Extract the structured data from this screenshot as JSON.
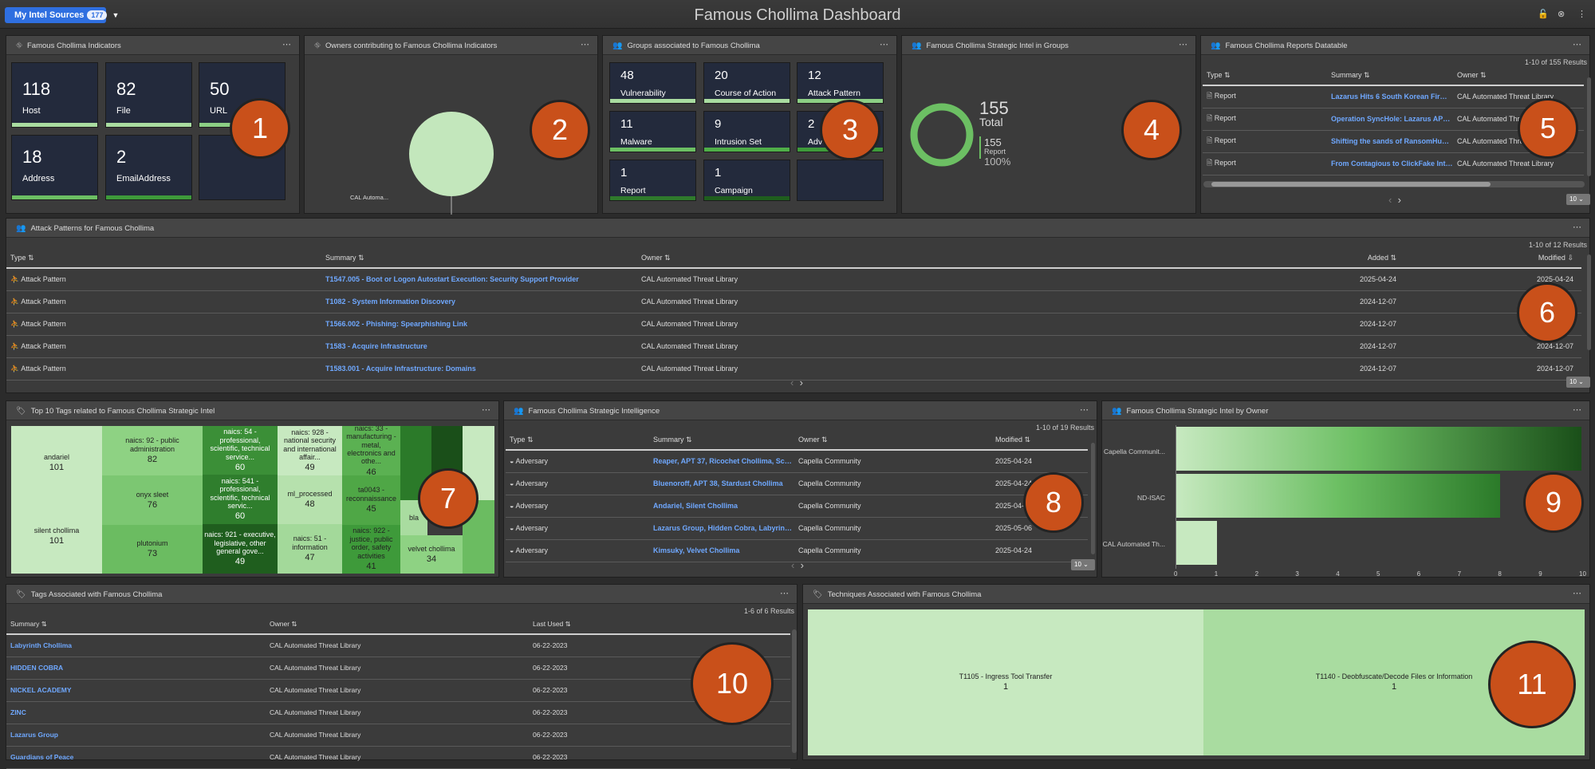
{
  "app": {
    "sources_label": "My Intel Sources",
    "sources_count": "177",
    "title": "Famous Chollima Dashboard"
  },
  "icons": {
    "lock": "lock-icon",
    "close": "close-circle-icon",
    "more": "more-vertical-icon"
  },
  "badges": [
    "1",
    "2",
    "3",
    "4",
    "5",
    "6",
    "7",
    "8",
    "9",
    "10",
    "11"
  ],
  "p1": {
    "title": "Famous Chollima Indicators",
    "tiles": [
      {
        "value": "118",
        "label": "Host"
      },
      {
        "value": "82",
        "label": "File"
      },
      {
        "value": "50",
        "label": "URL"
      },
      {
        "value": "18",
        "label": "Address"
      },
      {
        "value": "2",
        "label": "EmailAddress"
      }
    ]
  },
  "p2": {
    "title": "Owners contributing to Famous Chollima Indicators",
    "slice_label": "CAL Automa..."
  },
  "p3": {
    "title": "Groups associated to Famous Chollima",
    "tiles": [
      {
        "value": "48",
        "label": "Vulnerability"
      },
      {
        "value": "20",
        "label": "Course of Action"
      },
      {
        "value": "12",
        "label": "Attack Pattern"
      },
      {
        "value": "11",
        "label": "Malware"
      },
      {
        "value": "9",
        "label": "Intrusion Set"
      },
      {
        "value": "2",
        "label": "Adversary"
      },
      {
        "value": "1",
        "label": "Report"
      },
      {
        "value": "1",
        "label": "Campaign"
      }
    ]
  },
  "p4": {
    "title": "Famous Chollima Strategic Intel in Groups",
    "total": "155",
    "total_label": "Total",
    "sub_value": "155",
    "sub_label": "Report",
    "percent": "100%"
  },
  "p5": {
    "title": "Famous Chollima Reports Datatable",
    "results": "1-10 of 155 Results",
    "columns": [
      "Type",
      "Summary",
      "Owner"
    ],
    "rows": [
      [
        "Report",
        "Lazarus Hits 6 South Korean Firms v...",
        "CAL Automated Threat Library"
      ],
      [
        "Report",
        "Operation SyncHole: Lazarus APT g...",
        "CAL Automated Threat Library"
      ],
      [
        "Report",
        "Shifting the sands of RansomHub's ...",
        "CAL Automated Threat Library"
      ],
      [
        "Report",
        "From Contagious to ClickFake Interv...",
        "CAL Automated Threat Library"
      ]
    ],
    "page_size": "10"
  },
  "p6": {
    "title": "Attack Patterns for Famous Chollima",
    "results": "1-10 of 12 Results",
    "columns": [
      "Type",
      "Summary",
      "Owner",
      "Added",
      "Modified"
    ],
    "rows": [
      [
        "Attack Pattern",
        "T1547.005 - Boot or Logon Autostart Execution: Security Support Provider",
        "CAL Automated Threat Library",
        "2025-04-24",
        "2025-04-24"
      ],
      [
        "Attack Pattern",
        "T1082 - System Information Discovery",
        "CAL Automated Threat Library",
        "2024-12-07",
        "2024-12-07"
      ],
      [
        "Attack Pattern",
        "T1566.002 - Phishing: Spearphishing Link",
        "CAL Automated Threat Library",
        "2024-12-07",
        "2024-12-07"
      ],
      [
        "Attack Pattern",
        "T1583 - Acquire Infrastructure",
        "CAL Automated Threat Library",
        "2024-12-07",
        "2024-12-07"
      ],
      [
        "Attack Pattern",
        "T1583.001 - Acquire Infrastructure: Domains",
        "CAL Automated Threat Library",
        "2024-12-07",
        "2024-12-07"
      ]
    ],
    "page_size": "10"
  },
  "p7": {
    "title": "Top 10 Tags related to Famous Chollima Strategic Intel",
    "cells": [
      {
        "label": "andariel",
        "value": "101"
      },
      {
        "label": "silent chollima",
        "value": "101"
      },
      {
        "label": "naics: 92 - public administration",
        "value": "82"
      },
      {
        "label": "onyx sleet",
        "value": "76"
      },
      {
        "label": "plutonium",
        "value": "73"
      },
      {
        "label": "naics: 54 - professional, scientific, technical service...",
        "value": "60"
      },
      {
        "label": "naics: 541 - professional, scientific, technical servic...",
        "value": "60"
      },
      {
        "label": "naics: 921 - executive, legislative, other general gove...",
        "value": "49"
      },
      {
        "label": "naics: 928 - national security and international affair...",
        "value": "49"
      },
      {
        "label": "ml_processed",
        "value": "48"
      },
      {
        "label": "naics: 51 - information",
        "value": "47"
      },
      {
        "label": "naics: 33 - manufacturing - metal, electronics and othe...",
        "value": "46"
      },
      {
        "label": "ta0043 - reconnaissance",
        "value": "45"
      },
      {
        "label": "naics: 922 - justice, public order, safety activities",
        "value": "41"
      },
      {
        "label": "bla",
        "value": ""
      },
      {
        "label": "velvet chollima",
        "value": "34"
      }
    ]
  },
  "p8": {
    "title": "Famous Chollima Strategic Intelligence",
    "results": "1-10 of 19 Results",
    "columns": [
      "Type",
      "Summary",
      "Owner",
      "Modified"
    ],
    "rows": [
      [
        "Adversary",
        "Reaper, APT 37, Ricochet Chollima, ScarCr...",
        "Capella Community",
        "2025-04-24"
      ],
      [
        "Adversary",
        "Bluenoroff, APT 38, Stardust Chollima",
        "Capella Community",
        "2025-04-24"
      ],
      [
        "Adversary",
        "Andariel, Silent Chollima",
        "Capella Community",
        "2025-04-24"
      ],
      [
        "Adversary",
        "Lazarus Group, Hidden Cobra, Labyrinth C...",
        "Capella Community",
        "2025-05-06"
      ],
      [
        "Adversary",
        "Kimsuky, Velvet Chollima",
        "Capella Community",
        "2025-04-24"
      ]
    ],
    "page_size": "10"
  },
  "p9": {
    "title": "Famous Chollima Strategic Intel by Owner"
  },
  "p10": {
    "title": "Tags Associated with Famous Chollima",
    "results": "1-6 of 6 Results",
    "columns": [
      "Summary",
      "Owner",
      "Last Used"
    ],
    "rows": [
      [
        "Labyrinth Chollima",
        "CAL Automated Threat Library",
        "06-22-2023"
      ],
      [
        "HIDDEN COBRA",
        "CAL Automated Threat Library",
        "06-22-2023"
      ],
      [
        "NICKEL ACADEMY",
        "CAL Automated Threat Library",
        "06-22-2023"
      ],
      [
        "ZINC",
        "CAL Automated Threat Library",
        "06-22-2023"
      ],
      [
        "Lazarus Group",
        "CAL Automated Threat Library",
        "06-22-2023"
      ],
      [
        "Guardians of Peace",
        "CAL Automated Threat Library",
        "06-22-2023"
      ]
    ]
  },
  "p11": {
    "title": "Techniques Associated with Famous Chollima",
    "cells": [
      {
        "label": "T1105 - Ingress Tool Transfer",
        "value": "1"
      },
      {
        "label": "T1140 - Deobfuscate/Decode Files or Information",
        "value": "1"
      }
    ]
  },
  "chart_data": [
    {
      "type": "pie",
      "categories": [
        "CAL Automa..."
      ],
      "values": [
        1
      ]
    },
    {
      "type": "pie",
      "categories": [
        "Report"
      ],
      "values": [
        155
      ]
    },
    {
      "type": "bar",
      "orientation": "horizontal",
      "categories": [
        "Capella Communit...",
        "ND-ISAC",
        "CAL Automated Th..."
      ],
      "values": [
        10,
        8,
        1
      ],
      "xlim": [
        0,
        10
      ],
      "xticks": [
        0,
        1,
        2,
        3,
        4,
        5,
        6,
        7,
        8,
        9,
        10
      ]
    }
  ]
}
